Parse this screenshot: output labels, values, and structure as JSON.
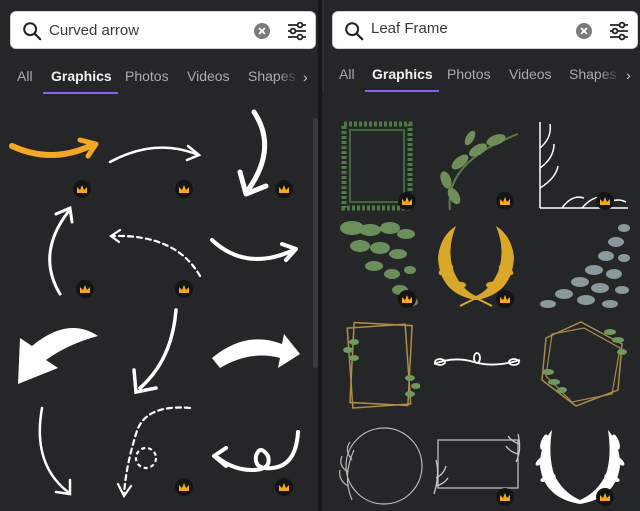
{
  "left_panel": {
    "search": {
      "value": "Curved arrow",
      "icon": "search-icon",
      "clear_icon": "clear-icon",
      "filter_icon": "sliders-icon"
    },
    "tabs": [
      {
        "label": "All",
        "active": false
      },
      {
        "label": "Graphics",
        "active": true
      },
      {
        "label": "Photos",
        "active": false
      },
      {
        "label": "Videos",
        "active": false
      },
      {
        "label": "Shapes",
        "active": false
      }
    ],
    "more_icon": "chevron-right-icon"
  },
  "right_panel": {
    "search": {
      "value": "Leaf Frame",
      "icon": "search-icon",
      "clear_icon": "clear-icon",
      "filter_icon": "sliders-icon"
    },
    "tabs": [
      {
        "label": "All",
        "active": false
      },
      {
        "label": "Graphics",
        "active": true
      },
      {
        "label": "Photos",
        "active": false
      },
      {
        "label": "Videos",
        "active": false
      },
      {
        "label": "Shapes",
        "active": false
      }
    ],
    "more_icon": "chevron-right-icon"
  },
  "colors": {
    "accent": "#8b5cf6",
    "crown": "#f5a623",
    "panel_bg": "#252627"
  }
}
